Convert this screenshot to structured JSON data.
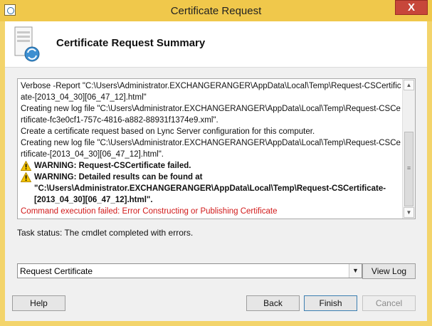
{
  "window": {
    "title": "Certificate Request",
    "close_label": "X"
  },
  "header": {
    "title": "Certificate Request Summary"
  },
  "log": {
    "lines": [
      "Verbose -Report \"C:\\Users\\Administrator.EXCHANGERANGER\\AppData\\Local\\Temp\\Request-CSCertificate-[2013_04_30][06_47_12].html\"",
      "Creating new log file \"C:\\Users\\Administrator.EXCHANGERANGER\\AppData\\Local\\Temp\\Request-CSCertificate-fc3e0cf1-757c-4816-a882-88931f1374e9.xml\".",
      "Create a certificate request based on Lync Server configuration for this computer.",
      "Creating new log file \"C:\\Users\\Administrator.EXCHANGERANGER\\AppData\\Local\\Temp\\Request-CSCertificate-[2013_04_30][06_47_12].html\"."
    ],
    "warning1": "WARNING: Request-CSCertificate failed.",
    "warning2": "WARNING: Detailed results can be found at \"C:\\Users\\Administrator.EXCHANGERANGER\\AppData\\Local\\Temp\\Request-CSCertificate-[2013_04_30][06_47_12].html\".",
    "error": "Command execution failed: Error Constructing or Publishing Certificate"
  },
  "task_status": "Task status: The cmdlet completed with errors.",
  "action_select": {
    "value": "Request Certificate"
  },
  "buttons": {
    "view_log": "View Log",
    "help": "Help",
    "back": "Back",
    "finish": "Finish",
    "cancel": "Cancel"
  },
  "colors": {
    "frame": "#f0c84b",
    "error_text": "#d11a1a",
    "close_button": "#c7473a"
  }
}
